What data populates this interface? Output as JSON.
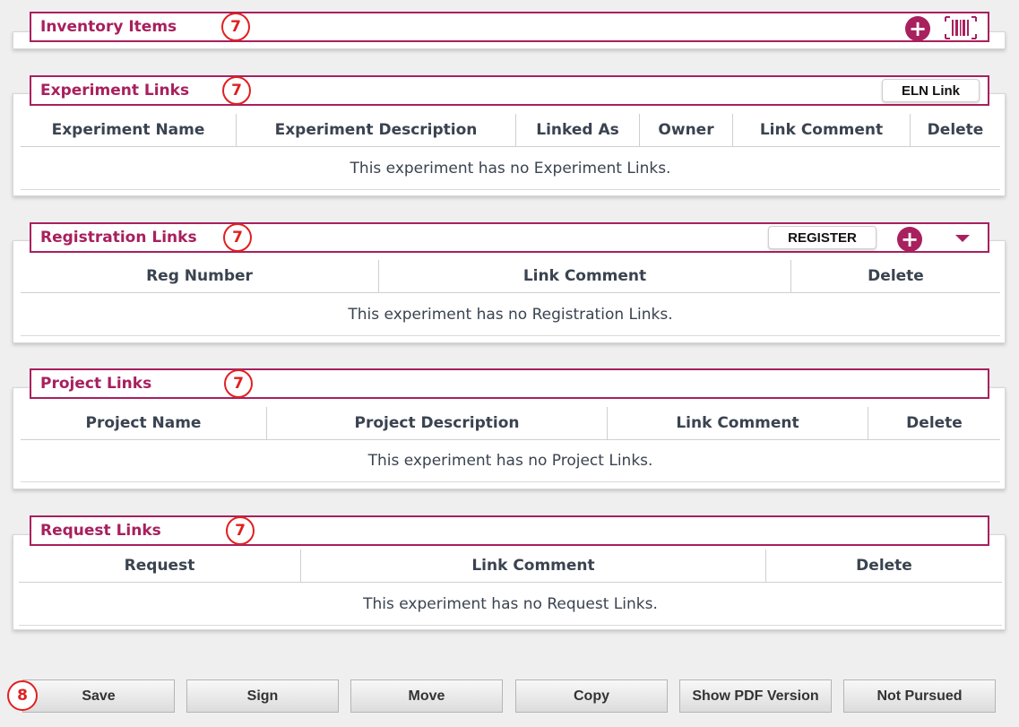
{
  "inventory": {
    "title": "Inventory Items",
    "badge": "7",
    "icons": [
      "plus-circle-icon",
      "barcode-icon"
    ]
  },
  "experiment_links": {
    "title": "Experiment Links",
    "badge": "7",
    "eln_button": "ELN Link",
    "columns": [
      "Experiment Name",
      "Experiment Description",
      "Linked As",
      "Owner",
      "Link Comment",
      "Delete"
    ],
    "empty": "This experiment has no Experiment Links."
  },
  "registration_links": {
    "title": "Registration Links",
    "badge": "7",
    "register_button": "REGISTER",
    "icons": [
      "plus-circle-icon",
      "caret-down-icon"
    ],
    "columns": [
      "Reg Number",
      "Link Comment",
      "Delete"
    ],
    "empty": "This experiment has no Registration Links."
  },
  "project_links": {
    "title": "Project Links",
    "badge": "7",
    "columns": [
      "Project Name",
      "Project Description",
      "Link Comment",
      "Delete"
    ],
    "empty": "This experiment has no Project Links."
  },
  "request_links": {
    "title": "Request Links",
    "badge": "7",
    "columns": [
      "Request",
      "Link Comment",
      "Delete"
    ],
    "empty": "This experiment has no Request Links."
  },
  "footer": {
    "badge": "8",
    "buttons": [
      "Save",
      "Sign",
      "Move",
      "Copy",
      "Show PDF Version",
      "Not Pursued"
    ]
  },
  "colors": {
    "accent": "#a8205e",
    "badge": "#e02020",
    "text": "#3a4350",
    "background": "#efefef"
  }
}
